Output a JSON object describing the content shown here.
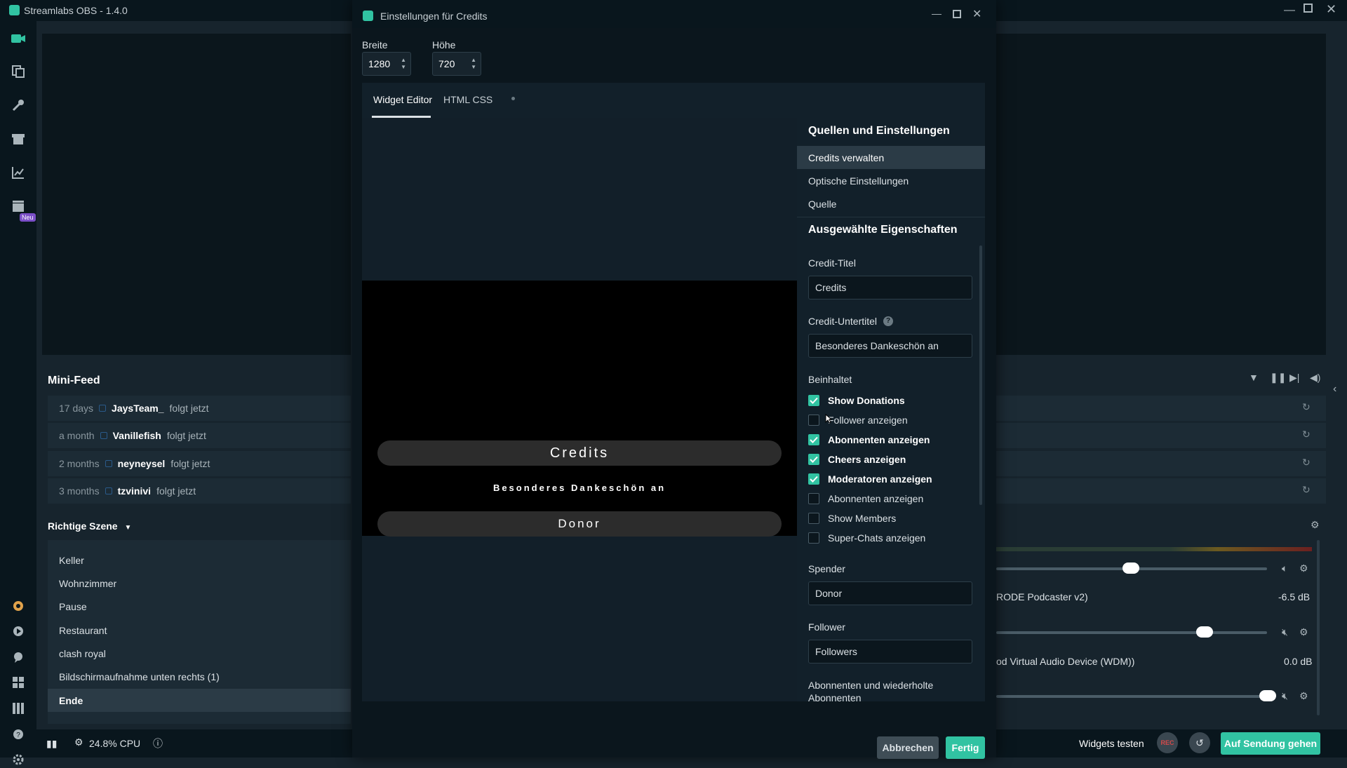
{
  "app": {
    "title": "Streamlabs OBS - 1.4.0",
    "nav_badge": "Neu"
  },
  "minifeed": {
    "title": "Mini-Feed",
    "items": [
      {
        "time": "17 days",
        "name": "JaysTeam_",
        "action": "folgt jetzt"
      },
      {
        "time": "a month",
        "name": "Vanillefish",
        "action": "folgt jetzt"
      },
      {
        "time": "2 months",
        "name": "neyneysel",
        "action": "folgt jetzt"
      },
      {
        "time": "3 months",
        "name": "tzvinivi",
        "action": "folgt jetzt"
      }
    ]
  },
  "scenes": {
    "title": "Richtige Szene",
    "items": [
      "Keller",
      "Wohnzimmer",
      "Pause",
      "Restaurant",
      "clash royal",
      "Bildschirmaufnahme unten rechts (1)",
      "Ende"
    ],
    "selected": "Ende"
  },
  "mixer": {
    "sources": [
      {
        "name": "RODE Podcaster v2)",
        "level": "-6.5 dB"
      },
      {
        "name": "od Virtual Audio Device (WDM))",
        "level": "0.0 dB"
      }
    ]
  },
  "status": {
    "cpu": "24.8% CPU"
  },
  "bottom_right": {
    "test_label": "Widgets testen",
    "rec_label": "REC",
    "go_live": "Auf Sendung gehen"
  },
  "dialog": {
    "title": "Einstellungen für Credits",
    "width_label": "Breite",
    "width_value": "1280",
    "height_label": "Höhe",
    "height_value": "720",
    "tabs": [
      "Widget Editor",
      "HTML CSS"
    ],
    "preview": {
      "title": "Credits",
      "subtitle": "Besonderes Dankeschön an",
      "donor": "Donor"
    },
    "sources_header": "Quellen und Einstellungen",
    "menu": [
      "Credits verwalten",
      "Optische Einstellungen",
      "Quelle"
    ],
    "props_header": "Ausgewählte Eigenschaften",
    "credit_title_label": "Credit-Titel",
    "credit_title_value": "Credits",
    "credit_subtitle_label": "Credit-Untertitel",
    "credit_subtitle_value": "Besonderes Dankeschön an",
    "includes_label": "Beinhaltet",
    "includes": [
      {
        "label": "Show Donations",
        "checked": true
      },
      {
        "label": "Follower anzeigen",
        "checked": false
      },
      {
        "label": "Abonnenten anzeigen",
        "checked": true
      },
      {
        "label": "Cheers anzeigen",
        "checked": true
      },
      {
        "label": "Moderatoren anzeigen",
        "checked": true
      },
      {
        "label": "Abonnenten anzeigen",
        "checked": false
      },
      {
        "label": "Show Members",
        "checked": false
      },
      {
        "label": "Super-Chats anzeigen",
        "checked": false
      }
    ],
    "donor_label": "Spender",
    "donor_value": "Donor",
    "follower_label": "Follower",
    "follower_value": "Followers",
    "subs_label": "Abonnenten und wiederholte Abonnenten",
    "cancel": "Abbrechen",
    "done": "Fertig"
  },
  "colors": {
    "accent": "#31c3a2",
    "bg": "#17242d",
    "dark": "#09161d"
  }
}
